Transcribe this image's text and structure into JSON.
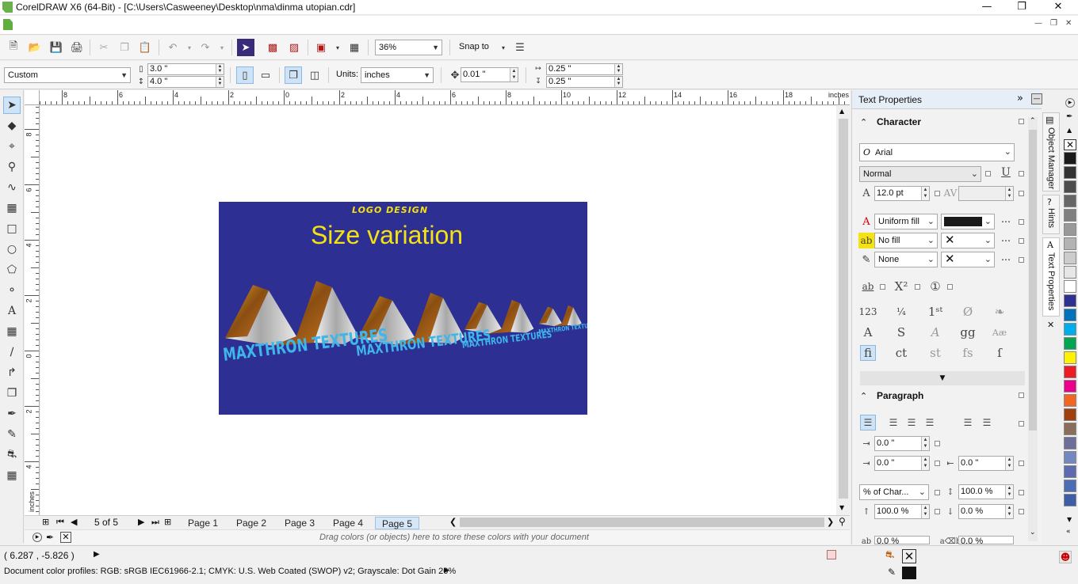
{
  "window": {
    "title": "CorelDRAW X6 (64-Bit) - [C:\\Users\\Casweeney\\Desktop\\nma\\dinma utopian.cdr]"
  },
  "toolbar": {
    "zoom_value": "36%",
    "snap_to_label": "Snap to"
  },
  "property_bar": {
    "page_size": "Custom",
    "width": "3.0 \"",
    "height": "4.0 \"",
    "units_label": "Units:",
    "units_value": "inches",
    "nudge": "0.01 \"",
    "dup_x": "0.25 \"",
    "dup_y": "0.25 \""
  },
  "rulers": {
    "unit": "inches",
    "h_labels": [
      "8",
      "6",
      "4",
      "2",
      "0",
      "2",
      "4",
      "6",
      "8",
      "10",
      "12",
      "14",
      "16",
      "18"
    ],
    "v_labels": [
      "8",
      "6",
      "4",
      "2",
      "0",
      "2",
      "4"
    ],
    "v_unit": "inches"
  },
  "artwork": {
    "heading": "LOGO DESIGN",
    "subheading": "Size variation",
    "logo_text": "MAXTHRON TEXTURES",
    "bg_color": "#2d2f93",
    "heading_color": "#f5e211",
    "logo_text_color": "#3fb6ea"
  },
  "pages": {
    "counter": "5 of 5",
    "tabs": [
      "Page 1",
      "Page 2",
      "Page 3",
      "Page 4",
      "Page 5"
    ],
    "active": "Page 5"
  },
  "document_palette": {
    "hint": "Drag colors (or objects) here to store these colors with your document"
  },
  "status": {
    "coords": "( 6.287 , -5.826 )",
    "profiles": "Document color profiles: RGB: sRGB IEC61966-2.1; CMYK: U.S. Web Coated (SWOP) v2; Grayscale: Dot Gain 20%"
  },
  "docker": {
    "title": "Text Properties",
    "character_header": "Character",
    "font_name": "Arial",
    "font_style": "Normal",
    "font_size": "12.0 pt",
    "fill_type": "Uniform fill",
    "bg_fill": "No fill",
    "outline": "None",
    "paragraph_header": "Paragraph",
    "indent_first": "0.0 \"",
    "indent_left": "0.0 \"",
    "indent_right": "0.0 \"",
    "line_spacing_unit": "% of Char...",
    "line_spacing": "100.0 %",
    "before_para": "100.0 %",
    "after_para": "0.0 %",
    "char_spacing": "0.0 %",
    "word_spacing": "0.0 %",
    "fill_color": "#1a1a1a"
  },
  "docker_tabs": [
    "Object Manager",
    "Hints",
    "Text Properties"
  ],
  "palette_colors": [
    "#1a1a1a",
    "#333333",
    "#4d4d4d",
    "#666666",
    "#808080",
    "#999999",
    "#b3b3b3",
    "#cccccc",
    "#e6e6e6",
    "#ffffff",
    "#2e3192",
    "#0072bc",
    "#00aeef",
    "#00a651",
    "#fff200",
    "#ed1c24",
    "#ec008c",
    "#f26522",
    "#a0410d",
    "#8b6e5a",
    "#6d6e9a",
    "#7388c1",
    "#5d6bb0",
    "#4a6db5",
    "#3d5da8"
  ]
}
